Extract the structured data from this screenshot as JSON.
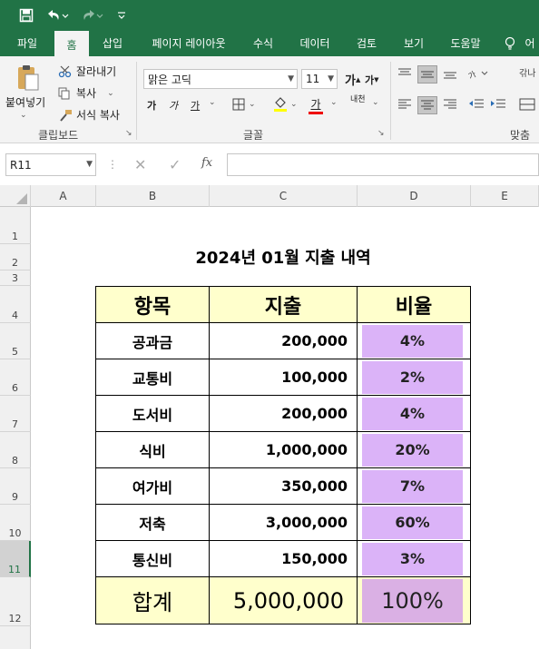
{
  "ribbon_tabs": [
    "파일",
    "홈",
    "삽입",
    "페이지 레이아웃",
    "수식",
    "데이터",
    "검토",
    "보기",
    "도움말",
    "어"
  ],
  "clipboard": {
    "paste": "붙여넣기",
    "cut": "잘라내기",
    "copy": "복사",
    "format_painter": "서식 복사",
    "group_label": "클립보드"
  },
  "font": {
    "name": "맑은 고딕",
    "size": "11",
    "bold": "가",
    "italic": "가",
    "underline": "가",
    "increase": "가",
    "decrease": "가",
    "color_letter": "가",
    "phonetic": "내천",
    "group_label": "글꼴"
  },
  "align": {
    "group_label": "맞춤",
    "wrap": "갂나"
  },
  "formula_bar": {
    "name_box": "R11",
    "fx": "fx",
    "value": ""
  },
  "columns": [
    "A",
    "B",
    "C",
    "D",
    "E"
  ],
  "rows": [
    "1",
    "2",
    "3",
    "4",
    "5",
    "6",
    "7",
    "8",
    "9",
    "10",
    "11",
    "12"
  ],
  "selected_row": "11",
  "sheet": {
    "title": "2024년 01월 지출 내역",
    "headers": {
      "item": "항목",
      "expense": "지출",
      "ratio": "비율"
    },
    "rows": [
      {
        "item": "공과금",
        "expense": "200,000",
        "ratio": "4%"
      },
      {
        "item": "교통비",
        "expense": "100,000",
        "ratio": "2%"
      },
      {
        "item": "도서비",
        "expense": "200,000",
        "ratio": "4%"
      },
      {
        "item": "식비",
        "expense": "1,000,000",
        "ratio": "20%"
      },
      {
        "item": "여가비",
        "expense": "350,000",
        "ratio": "7%"
      },
      {
        "item": "저축",
        "expense": "3,000,000",
        "ratio": "60%"
      },
      {
        "item": "통신비",
        "expense": "150,000",
        "ratio": "3%"
      }
    ],
    "total": {
      "item": "합계",
      "expense": "5,000,000",
      "ratio": "100%"
    }
  },
  "colors": {
    "excel_green": "#217346",
    "header_fill": "#ffffcc",
    "ratio_fill": "#dbb3f8",
    "total_ratio_fill": "#dab0e4"
  }
}
